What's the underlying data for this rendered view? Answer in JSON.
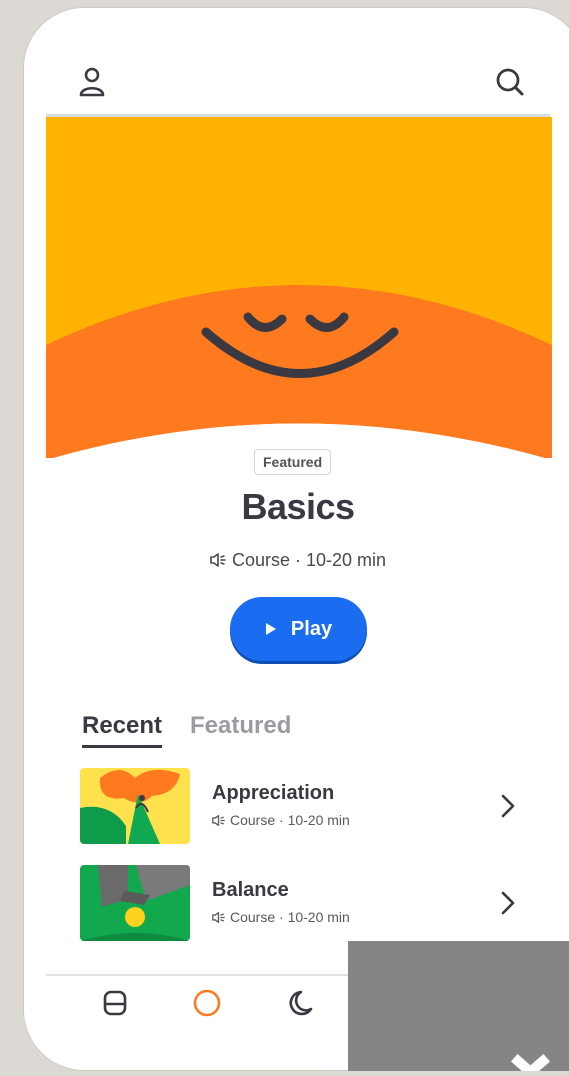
{
  "header": {
    "profile_icon": "person-icon",
    "search_icon": "search-icon"
  },
  "hero": {
    "colors": {
      "sky": "#FFB300",
      "sun": "#FF7A1F",
      "face": "#3A3840"
    }
  },
  "featured": {
    "badge": "Featured",
    "title": "Basics",
    "meta": "Course · 10-20 min",
    "play_label": "Play",
    "play_color": "#1A6CF0"
  },
  "tabs": [
    {
      "label": "Recent",
      "active": true
    },
    {
      "label": "Featured",
      "active": false
    }
  ],
  "list": [
    {
      "title": "Appreciation",
      "meta": "Course · 10-20 min"
    },
    {
      "title": "Balance",
      "meta": "Course · 10-20 min"
    }
  ],
  "bottom_nav": [
    {
      "icon": "home-icon",
      "active": false
    },
    {
      "icon": "meditate-icon",
      "active": true,
      "color": "#FF7A1F"
    },
    {
      "icon": "sleep-moon-icon",
      "active": false
    }
  ]
}
